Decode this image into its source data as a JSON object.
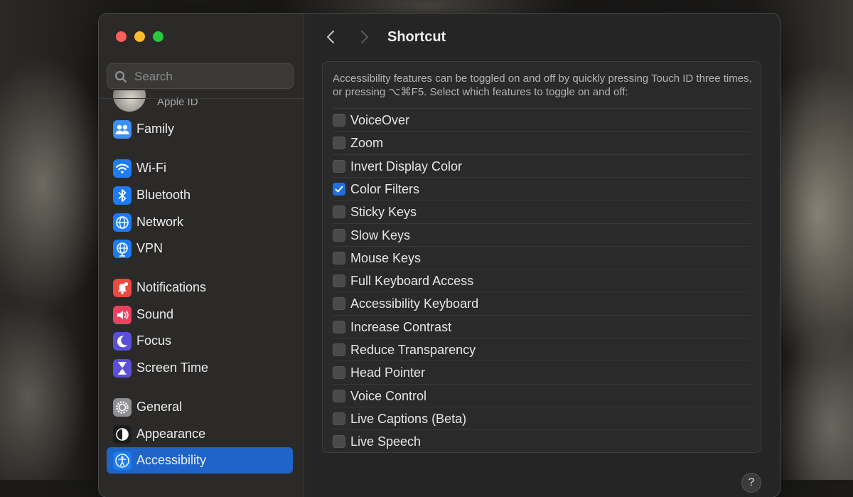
{
  "sidebar": {
    "search_placeholder": "Search",
    "apple_id_label": "Apple ID",
    "items": [
      {
        "label": "Family",
        "icon": "family-icon",
        "color": "#3b8ff5"
      },
      {
        "label": "Wi-Fi",
        "icon": "wifi-icon",
        "color": "#1d7cf2"
      },
      {
        "label": "Bluetooth",
        "icon": "bluetooth-icon",
        "color": "#1d7cf2"
      },
      {
        "label": "Network",
        "icon": "globe-icon",
        "color": "#1d7cf2"
      },
      {
        "label": "VPN",
        "icon": "vpn-globe-icon",
        "color": "#1d7cf2"
      },
      {
        "label": "Notifications",
        "icon": "bell-icon",
        "color": "#f0473f"
      },
      {
        "label": "Sound",
        "icon": "speaker-icon",
        "color": "#f0405f"
      },
      {
        "label": "Focus",
        "icon": "moon-icon",
        "color": "#5a4fd6"
      },
      {
        "label": "Screen Time",
        "icon": "hourglass-icon",
        "color": "#5a4fd6"
      },
      {
        "label": "General",
        "icon": "gear-icon",
        "color": "#8e8e93"
      },
      {
        "label": "Appearance",
        "icon": "appearance-icon",
        "color": "#1c1c1e"
      },
      {
        "label": "Accessibility",
        "icon": "accessibility-icon",
        "color": "#1d7cf2",
        "selected": true
      }
    ]
  },
  "header": {
    "title": "Shortcut"
  },
  "panel": {
    "description": "Accessibility features can be toggled on and off by quickly pressing Touch ID three times, or pressing ⌥⌘F5. Select which features to toggle on and off:",
    "options": [
      {
        "label": "VoiceOver",
        "checked": false
      },
      {
        "label": "Zoom",
        "checked": false
      },
      {
        "label": "Invert Display Color",
        "checked": false
      },
      {
        "label": "Color Filters",
        "checked": true
      },
      {
        "label": "Sticky Keys",
        "checked": false
      },
      {
        "label": "Slow Keys",
        "checked": false
      },
      {
        "label": "Mouse Keys",
        "checked": false
      },
      {
        "label": "Full Keyboard Access",
        "checked": false
      },
      {
        "label": "Accessibility Keyboard",
        "checked": false
      },
      {
        "label": "Increase Contrast",
        "checked": false
      },
      {
        "label": "Reduce Transparency",
        "checked": false
      },
      {
        "label": "Head Pointer",
        "checked": false
      },
      {
        "label": "Voice Control",
        "checked": false
      },
      {
        "label": "Live Captions (Beta)",
        "checked": false
      },
      {
        "label": "Live Speech",
        "checked": false
      }
    ]
  },
  "help_label": "?"
}
